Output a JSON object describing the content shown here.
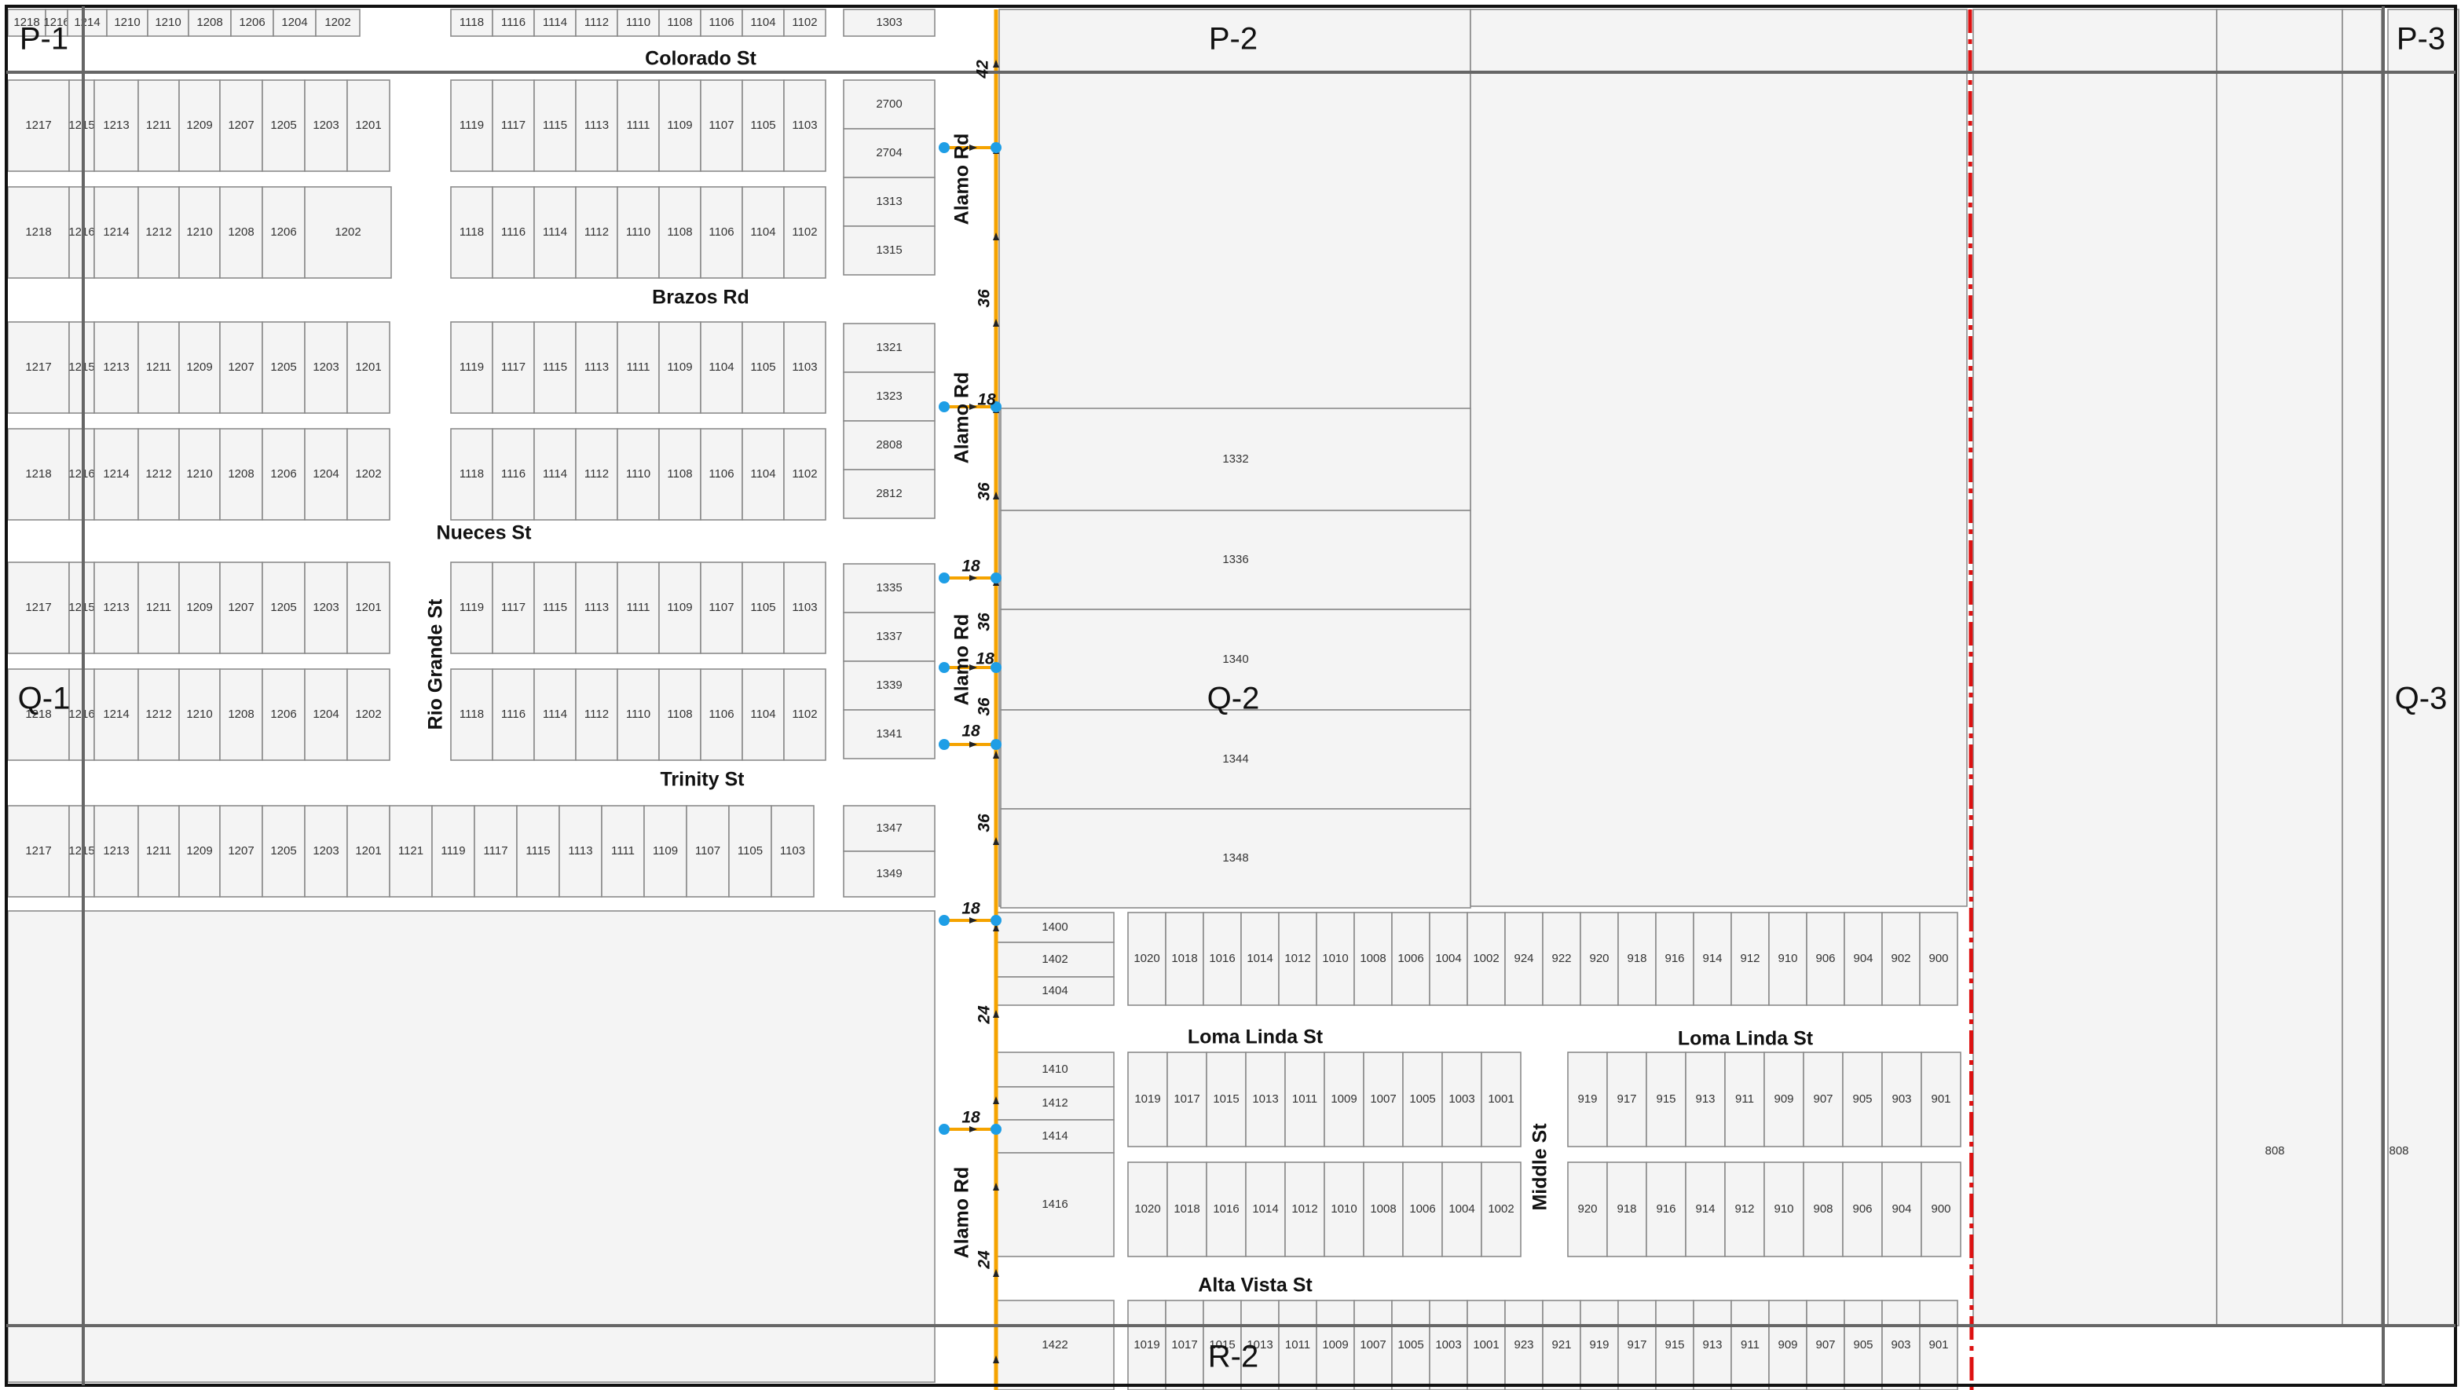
{
  "colors": {
    "background": "#ffffff",
    "parcel_fill": "#f4f4f4",
    "parcel_stroke": "#8a8a8a",
    "grid_line": "#666666",
    "frame": "#111111",
    "main_road": "#f5a300",
    "boundary": "#dd1111",
    "marker": "#1e9ee6"
  },
  "grid_labels": [
    "P-1",
    "P-2",
    "P-3",
    "Q-1",
    "Q-2",
    "Q-3",
    "R-2"
  ],
  "streets": {
    "colorado": "Colorado St",
    "brazos": "Brazos Rd",
    "nueces": "Nueces St",
    "trinity": "Trinity St",
    "rio_grande": "Rio Grande St",
    "alamo_1": "Alamo Rd",
    "alamo_2": "Alamo Rd",
    "alamo_3": "Alamo Rd",
    "alamo_4": "Alamo Rd",
    "loma_linda_1": "Loma Linda St",
    "loma_linda_2": "Loma Linda St",
    "middle": "Middle St",
    "alta_vista": "Alta Vista St"
  },
  "road_widths": {
    "w1": "42",
    "w2": "36",
    "w3": "18",
    "w4": "36",
    "w5": "18",
    "w6": "36",
    "w7": "18",
    "w8": "36",
    "w9": "18",
    "w10": "36",
    "w11": "18",
    "w12": "24",
    "w13": "18",
    "w14": "24"
  },
  "lots": {
    "r0a": [
      "1218",
      "1216",
      "1214",
      "1210",
      "1210",
      "1208",
      "1206",
      "1204",
      "1202"
    ],
    "r0b": [
      "1118",
      "1116",
      "1114",
      "1112",
      "1110",
      "1108",
      "1106",
      "1104",
      "1102"
    ],
    "r1a": [
      "1217",
      "1215",
      "1213",
      "1211",
      "1209",
      "1207",
      "1205",
      "1203",
      "1201"
    ],
    "r1b": [
      "1119",
      "1117",
      "1115",
      "1113",
      "1111",
      "1109",
      "1107",
      "1105",
      "1103"
    ],
    "r2a": [
      "1218",
      "1216",
      "1214",
      "1212",
      "1210",
      "1208",
      "1206",
      "1202"
    ],
    "r2b": [
      "1118",
      "1116",
      "1114",
      "1112",
      "1110",
      "1108",
      "1106",
      "1104",
      "1102"
    ],
    "r3a": [
      "1217",
      "1215",
      "1213",
      "1211",
      "1209",
      "1207",
      "1205",
      "1203",
      "1201"
    ],
    "r3b": [
      "1119",
      "1117",
      "1115",
      "1113",
      "1111",
      "1109",
      "1104",
      "1105",
      "1103"
    ],
    "r4a": [
      "1218",
      "1216",
      "1214",
      "1212",
      "1210",
      "1208",
      "1206",
      "1204",
      "1202"
    ],
    "r4b": [
      "1118",
      "1116",
      "1114",
      "1112",
      "1110",
      "1108",
      "1106",
      "1104",
      "1102"
    ],
    "r5a": [
      "1217",
      "1215",
      "1213",
      "1211",
      "1209",
      "1207",
      "1205",
      "1203",
      "1201"
    ],
    "r5b": [
      "1119",
      "1117",
      "1115",
      "1113",
      "1111",
      "1109",
      "1107",
      "1105",
      "1103"
    ],
    "r6a": [
      "1218",
      "1216",
      "1214",
      "1212",
      "1210",
      "1208",
      "1206",
      "1204",
      "1202"
    ],
    "r6b": [
      "1118",
      "1116",
      "1114",
      "1112",
      "1110",
      "1108",
      "1106",
      "1104",
      "1102"
    ],
    "r7": [
      "1217",
      "1215",
      "1213",
      "1211",
      "1209",
      "1207",
      "1205",
      "1203",
      "1201",
      "1121",
      "1119",
      "1117",
      "1115",
      "1113",
      "1111",
      "1109",
      "1107",
      "1105",
      "1103"
    ],
    "c1": [
      "1303",
      "2700",
      "2704",
      "1313",
      "1315",
      "1321",
      "1323",
      "2808",
      "2812",
      "1335",
      "1337",
      "1339",
      "1341",
      "1347",
      "1349"
    ],
    "big": [
      "1332",
      "1336",
      "1340",
      "1344",
      "1348"
    ],
    "c2": [
      "1400",
      "1402",
      "1404",
      "1410",
      "1412",
      "1414",
      "1416",
      "1422"
    ],
    "ll1": [
      "1020",
      "1018",
      "1016",
      "1014",
      "1012",
      "1010",
      "1008",
      "1006",
      "1004",
      "1002",
      "924",
      "922",
      "920",
      "918",
      "916",
      "914",
      "912",
      "910",
      "906",
      "904",
      "902",
      "900"
    ],
    "ll2a": [
      "1019",
      "1017",
      "1015",
      "1013",
      "1011",
      "1009",
      "1007",
      "1005",
      "1003",
      "1001"
    ],
    "ll2b": [
      "919",
      "917",
      "915",
      "913",
      "911",
      "909",
      "907",
      "905",
      "903",
      "901"
    ],
    "ll3a": [
      "1020",
      "1018",
      "1016",
      "1014",
      "1012",
      "1010",
      "1008",
      "1006",
      "1004",
      "1002"
    ],
    "ll3b": [
      "920",
      "918",
      "916",
      "914",
      "912",
      "910",
      "908",
      "906",
      "904",
      "900"
    ],
    "av": [
      "1019",
      "1017",
      "1015",
      "1013",
      "1011",
      "1009",
      "1007",
      "1005",
      "1003",
      "1001",
      "923",
      "921",
      "919",
      "917",
      "915",
      "913",
      "911",
      "909",
      "907",
      "905",
      "903",
      "901"
    ],
    "far": [
      "808",
      "808"
    ]
  }
}
